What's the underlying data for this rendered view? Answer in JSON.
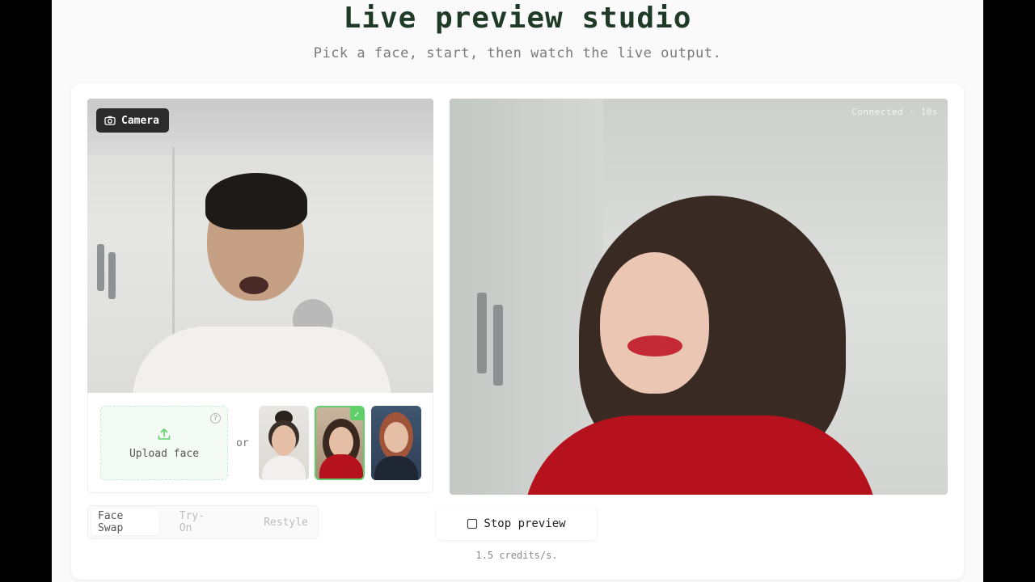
{
  "header": {
    "title": "Live preview studio",
    "subtitle": "Pick a face, start, then watch the live output."
  },
  "camera": {
    "badge_label": "Camera",
    "badge_icon": "camera-icon"
  },
  "picker": {
    "upload_label": "Upload face",
    "upload_icon": "upload-icon",
    "help_icon": "help-icon",
    "or_label": "or",
    "faces": [
      {
        "selected": false
      },
      {
        "selected": true
      },
      {
        "selected": false
      }
    ],
    "selected_color": "#5fcf6c"
  },
  "output": {
    "status": "Connected · 10s"
  },
  "modes": {
    "tabs": [
      "Face Swap",
      "Try-On",
      "Restyle"
    ],
    "active": "Face Swap"
  },
  "controls": {
    "stop_label": "Stop preview",
    "stop_icon": "stop-icon",
    "credits": "1.5 credits/s."
  },
  "colors": {
    "title": "#1f3a27",
    "accent": "#5fcf6c",
    "upload_bg": "#f3fbf4"
  }
}
